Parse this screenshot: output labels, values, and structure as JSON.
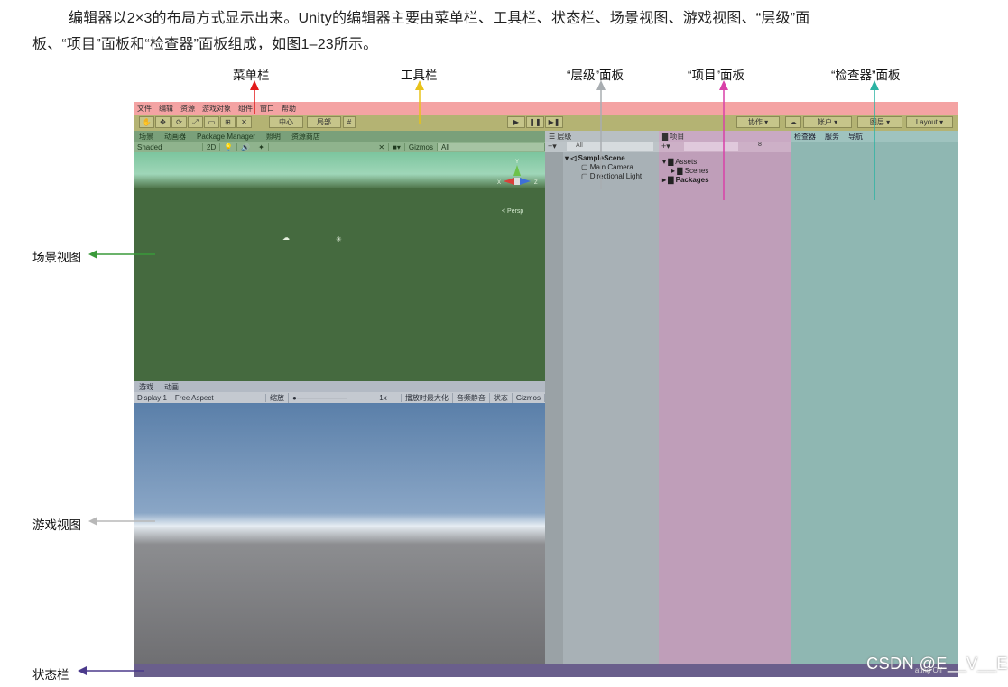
{
  "intro": {
    "line1": "编辑器以2×3的布局方式显示出来。Unity的编辑器主要由菜单栏、工具栏、状态栏、场景视图、游戏视图、“层级”面",
    "line2": "板、“项目”面板和“检查器”面板组成，如图1–23所示。"
  },
  "callouts": {
    "menubar": "菜单栏",
    "toolbar": "工具栏",
    "hierarchy": "“层级”面板",
    "project": "“项目”面板",
    "inspector": "“检查器”面板",
    "scene": "场景视图",
    "game": "游戏视图",
    "status": "状态栏"
  },
  "colors": {
    "menubar": "#e21b1b",
    "toolbar": "#e8c21a",
    "hierarchy": "#a8adb1",
    "project": "#d940a8",
    "inspector": "#2bb3a3",
    "scene": "#3a9a3a",
    "game": "#b8b8b8",
    "status": "#4b3a8c"
  },
  "menu": [
    "文件",
    "编辑",
    "资源",
    "游戏对象",
    "组件",
    "窗口",
    "帮助"
  ],
  "toolbar": {
    "tools": [
      "✋",
      "✥",
      "⟳",
      "⤢",
      "▭",
      "⊞",
      "✕"
    ],
    "pivot": "中心",
    "local": "局部",
    "collab": "协作",
    "account": "帐户",
    "layers": "图层",
    "layout": "Layout"
  },
  "scene": {
    "tabs": [
      "场景",
      "动画器",
      "Package Manager",
      "照明",
      "资源商店"
    ],
    "shaded": "Shaded",
    "mode2d": "2D",
    "gizmos": "Gizmos",
    "search": "All",
    "persp": "< Persp",
    "axis_x": "X",
    "axis_z": "Z",
    "axis_y": "Y"
  },
  "game": {
    "tabs": [
      "游戏",
      "动画"
    ],
    "display": "Display 1",
    "aspect": "Free Aspect",
    "scale_label": "缩放",
    "scale_value": "1x",
    "buttons": [
      "播放时最大化",
      "音频静音",
      "状态",
      "Gizmos"
    ]
  },
  "hierarchy": {
    "tab": "层级",
    "search": "All",
    "scene": "SampleScene",
    "items": [
      "Main Camera",
      "Directional Light"
    ]
  },
  "project": {
    "tab": "项目",
    "count": "8",
    "assets": "Assets",
    "scenes": "Scenes",
    "packages": "Packages"
  },
  "inspector": {
    "tabs": [
      "检查器",
      "服务",
      "导航"
    ]
  },
  "status": {
    "text": "ating Off"
  },
  "watermark": "CSDN @E__V__E"
}
